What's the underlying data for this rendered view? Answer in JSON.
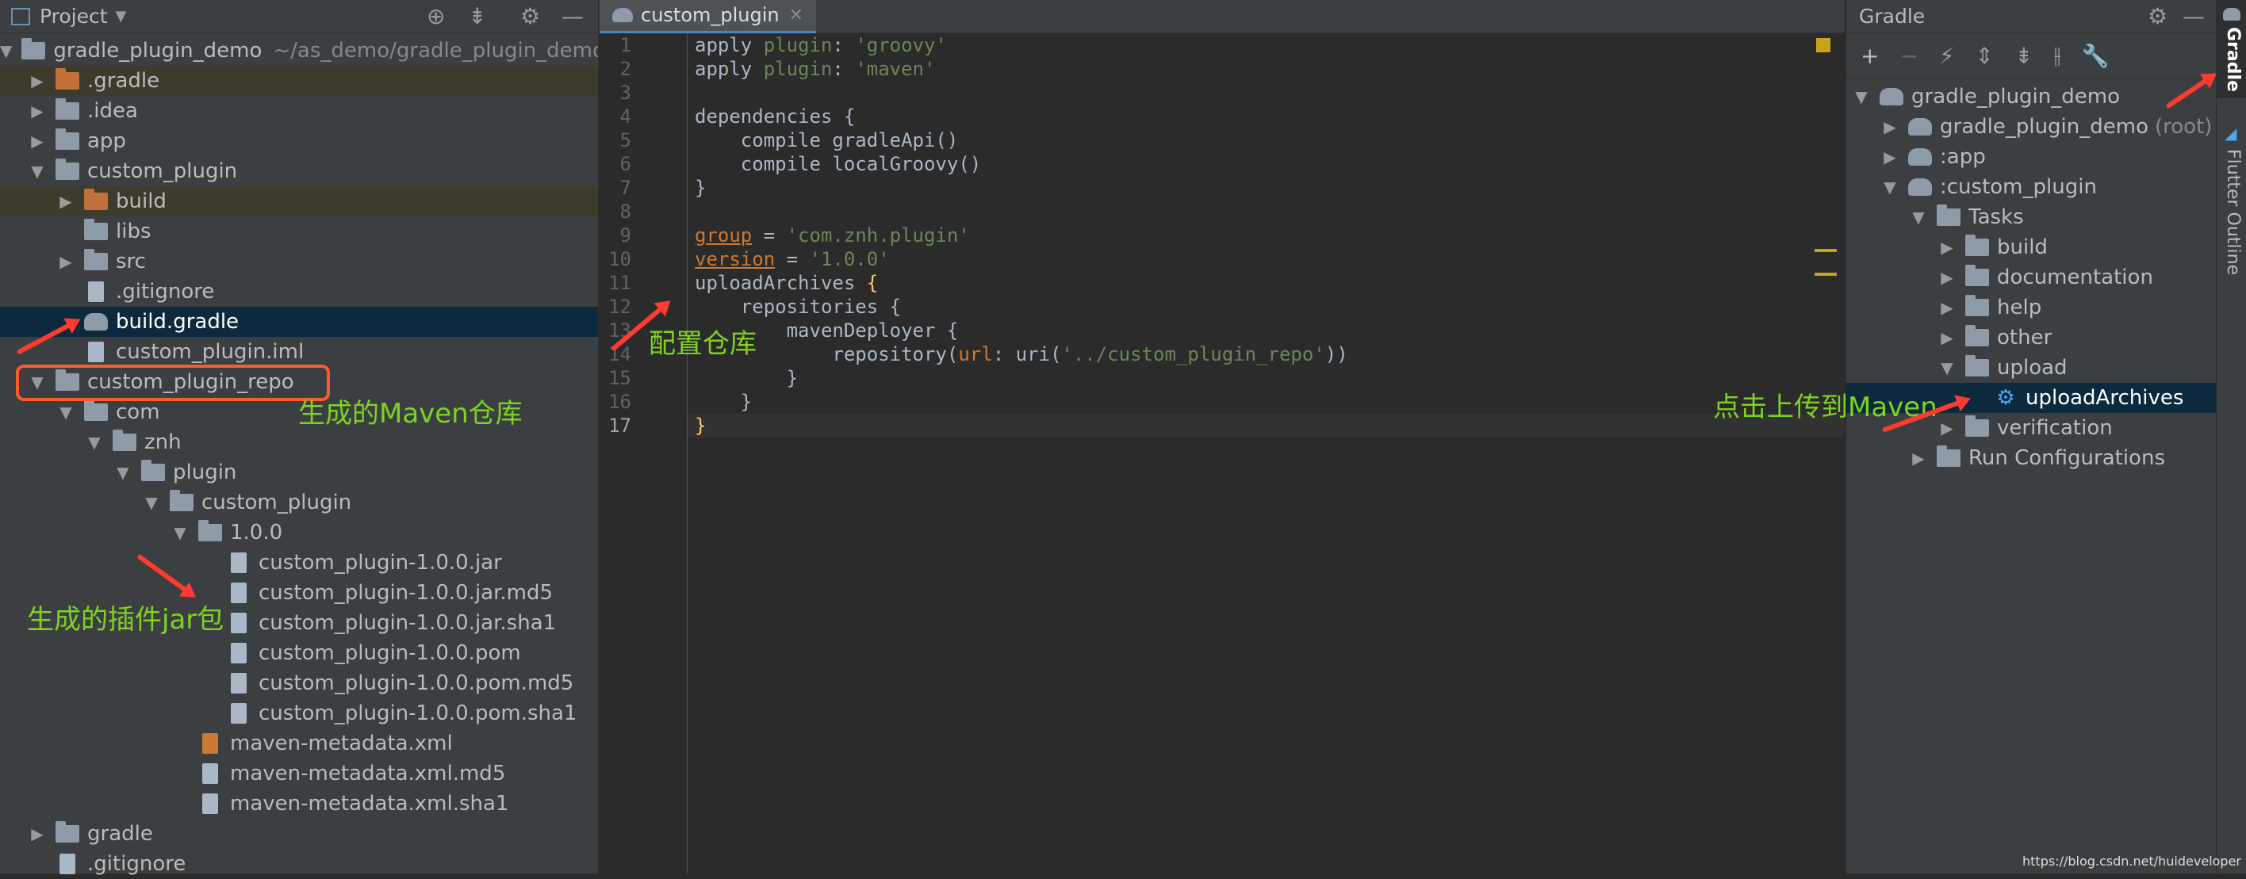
{
  "project_panel": {
    "title": "Project",
    "tree": [
      {
        "label": "gradle_plugin_demo",
        "path": "~/as_demo/gradle_plugin_demo"
      },
      {
        "label": ".gradle"
      },
      {
        "label": ".idea"
      },
      {
        "label": "app"
      },
      {
        "label": "custom_plugin"
      },
      {
        "label": "build"
      },
      {
        "label": "libs"
      },
      {
        "label": "src"
      },
      {
        "label": ".gitignore"
      },
      {
        "label": "build.gradle"
      },
      {
        "label": "custom_plugin.iml"
      },
      {
        "label": "custom_plugin_repo"
      },
      {
        "label": "com"
      },
      {
        "label": "znh"
      },
      {
        "label": "plugin"
      },
      {
        "label": "custom_plugin"
      },
      {
        "label": "1.0.0"
      },
      {
        "label": "custom_plugin-1.0.0.jar"
      },
      {
        "label": "custom_plugin-1.0.0.jar.md5"
      },
      {
        "label": "custom_plugin-1.0.0.jar.sha1"
      },
      {
        "label": "custom_plugin-1.0.0.pom"
      },
      {
        "label": "custom_plugin-1.0.0.pom.md5"
      },
      {
        "label": "custom_plugin-1.0.0.pom.sha1"
      },
      {
        "label": "maven-metadata.xml"
      },
      {
        "label": "maven-metadata.xml.md5"
      },
      {
        "label": "maven-metadata.xml.sha1"
      },
      {
        "label": "gradle"
      },
      {
        "label": ".gitignore"
      }
    ]
  },
  "editor": {
    "tab_label": "custom_plugin",
    "line_numbers": [
      "1",
      "2",
      "3",
      "4",
      "5",
      "6",
      "7",
      "8",
      "9",
      "10",
      "11",
      "12",
      "13",
      "14",
      "15",
      "16",
      "17"
    ]
  },
  "gradle_panel": {
    "title": "Gradle",
    "tree": [
      {
        "label": "gradle_plugin_demo"
      },
      {
        "label": "gradle_plugin_demo",
        "suffix": "(root)"
      },
      {
        "label": ":app"
      },
      {
        "label": ":custom_plugin"
      },
      {
        "label": "Tasks"
      },
      {
        "label": "build"
      },
      {
        "label": "documentation"
      },
      {
        "label": "help"
      },
      {
        "label": "other"
      },
      {
        "label": "upload"
      },
      {
        "label": "uploadArchives"
      },
      {
        "label": "verification"
      },
      {
        "label": "Run Configurations"
      }
    ]
  },
  "side_stripe": {
    "gradle_label": "Gradle",
    "flutter_label": "Flutter Outline"
  },
  "annotations": {
    "maven_repo": "生成的Maven仓库",
    "config_repo": "配置仓库",
    "plugin_jar": "生成的插件jar包",
    "upload_maven": "点击上传到Maven"
  },
  "watermark": "https://blog.csdn.net/huideveloper",
  "colors": {
    "annotation": "#7ed321",
    "arrow": "#ff3b30",
    "selection": "#0d293e"
  }
}
